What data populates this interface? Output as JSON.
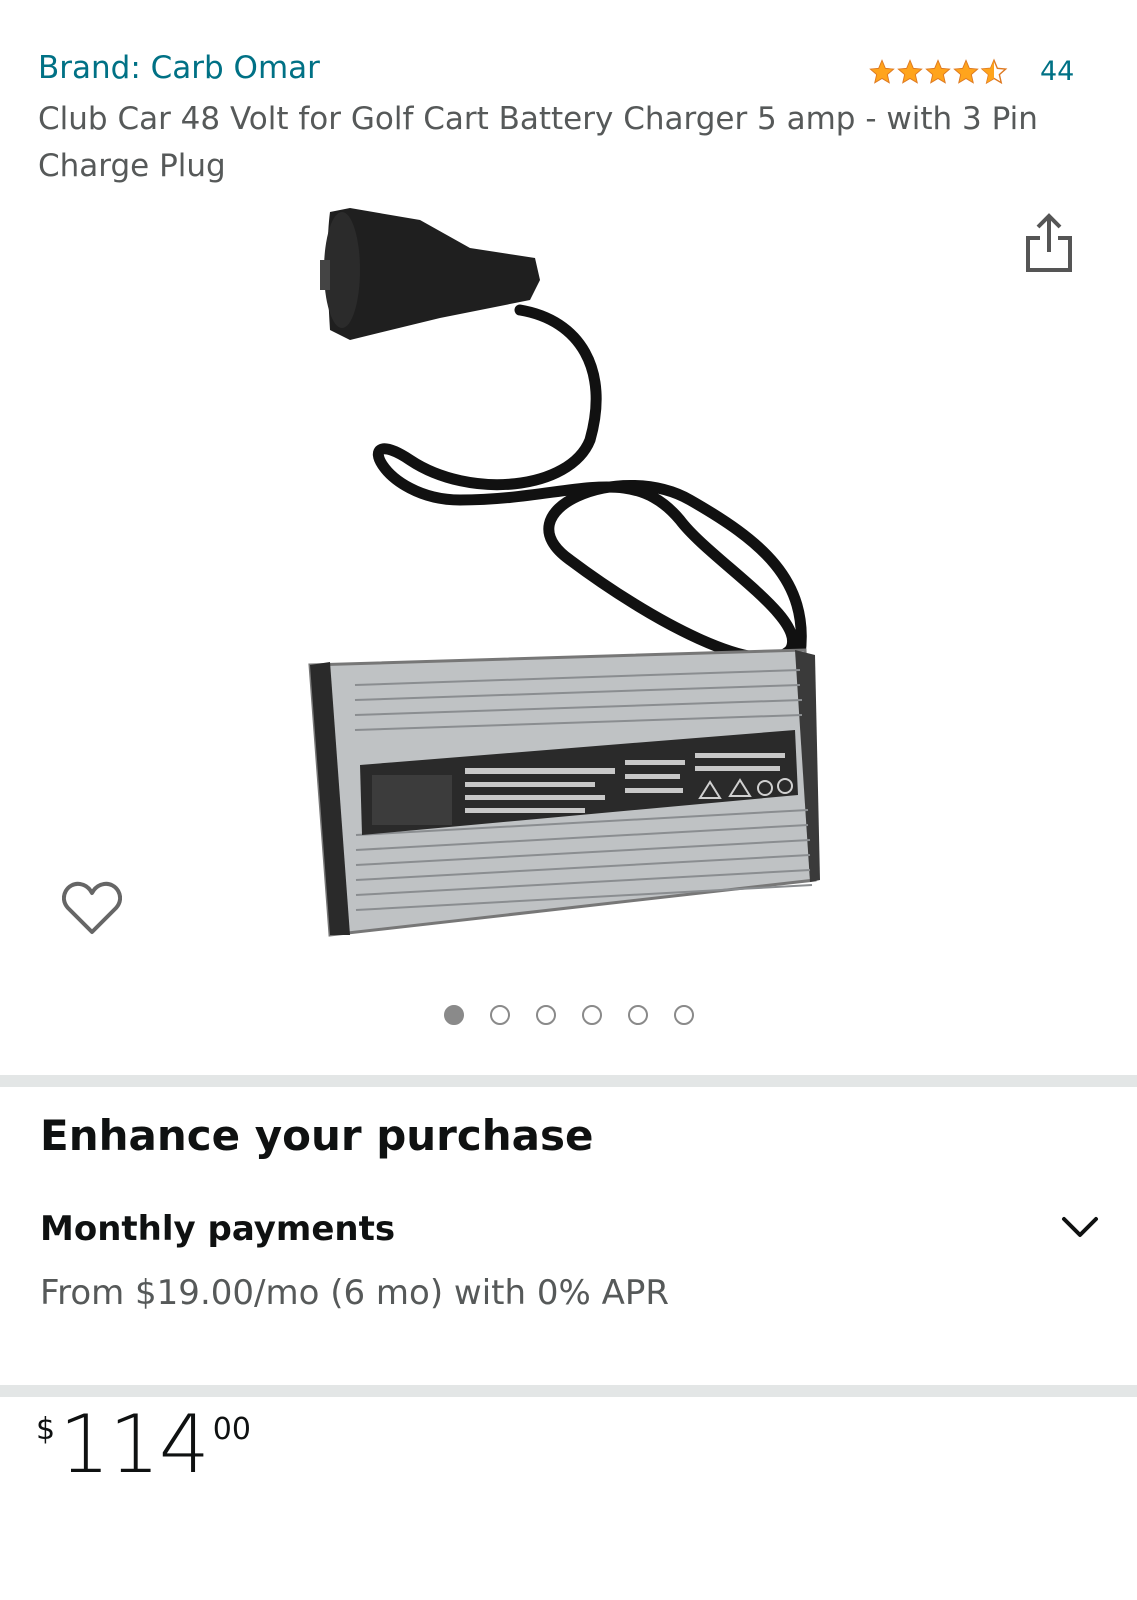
{
  "header": {
    "brand": "Brand: Carb Omar",
    "rating_count": "44",
    "rating_value": 4.5,
    "title": "Club Car 48 Volt for Golf Cart Battery Charger 5 amp - with 3 Pin Charge Plug"
  },
  "icons": {
    "share": "share-icon",
    "wishlist": "heart-icon",
    "expand": "chevron-down-icon"
  },
  "carousel": {
    "total": 6,
    "active_index": 0
  },
  "enhance": {
    "heading": "Enhance your purchase",
    "monthly_label": "Monthly payments",
    "monthly_detail": "From $19.00/mo (6 mo) with 0% APR"
  },
  "price": {
    "symbol": "$",
    "whole": "114",
    "fraction": "00"
  },
  "colors": {
    "link": "#007185",
    "star": "#ffa41c",
    "divider": "#e3e6e6"
  }
}
